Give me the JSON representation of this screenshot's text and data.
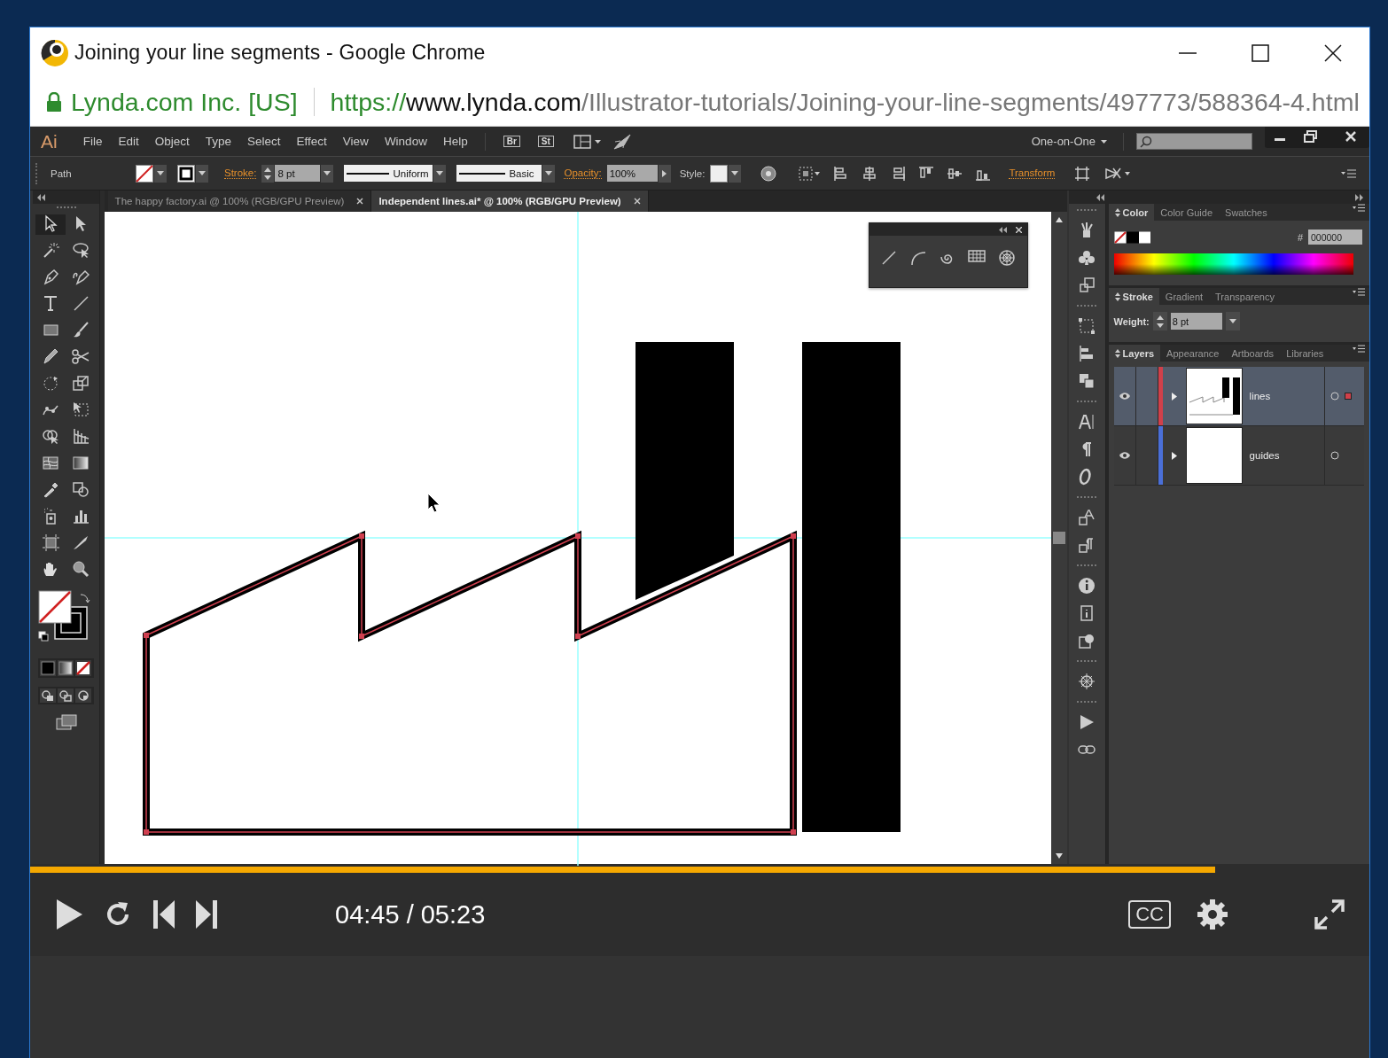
{
  "window": {
    "title": "Joining your line segments - Google Chrome"
  },
  "address_bar": {
    "site_identity": "Lynda.com Inc. [US]",
    "url_scheme": "https://",
    "url_host": "www.lynda.com",
    "url_path": "/Illustrator-tutorials/Joining-your-line-segments/497773/588364-4.html"
  },
  "video": {
    "app": {
      "logo": "Ai",
      "menu": [
        "File",
        "Edit",
        "Object",
        "Type",
        "Select",
        "Effect",
        "View",
        "Window",
        "Help"
      ],
      "bridge_button": "Br",
      "stock_button": "St",
      "workspace": "One-on-One",
      "control_bar": {
        "selection": "Path",
        "stroke_label": "Stroke:",
        "stroke_weight": "8 pt",
        "profile": "Uniform",
        "brush": "Basic",
        "opacity_label": "Opacity:",
        "opacity": "100%",
        "style_label": "Style:",
        "transform": "Transform"
      },
      "document_tabs": [
        {
          "label": "The happy factory.ai @ 100% (RGB/GPU Preview)",
          "selected": false
        },
        {
          "label": "Independent lines.ai* @ 100% (RGB/GPU Preview)",
          "selected": true
        }
      ],
      "color_panel": {
        "tabs": [
          {
            "label": "Color",
            "selected": true
          },
          {
            "label": "Color Guide",
            "selected": false
          },
          {
            "label": "Swatches",
            "selected": false
          }
        ],
        "hex_label": "#",
        "hex": "000000"
      },
      "stroke_panel": {
        "tabs": [
          {
            "label": "Stroke",
            "selected": true
          },
          {
            "label": "Gradient",
            "selected": false
          },
          {
            "label": "Transparency",
            "selected": false
          }
        ],
        "weight_label": "Weight:",
        "weight": "8 pt"
      },
      "layers_panel": {
        "tabs": [
          {
            "label": "Layers",
            "selected": true
          },
          {
            "label": "Appearance",
            "selected": false
          },
          {
            "label": "Artboards",
            "selected": false
          },
          {
            "label": "Libraries",
            "selected": false
          }
        ],
        "layers": [
          {
            "name": "lines",
            "color": "#d0404a",
            "selected": true
          },
          {
            "name": "guides",
            "color": "#4a6fd8",
            "selected": false
          }
        ]
      }
    },
    "player": {
      "progress": {
        "level": 0.885
      },
      "time": "04:45 / 05:23",
      "captions_button": "CC"
    }
  }
}
